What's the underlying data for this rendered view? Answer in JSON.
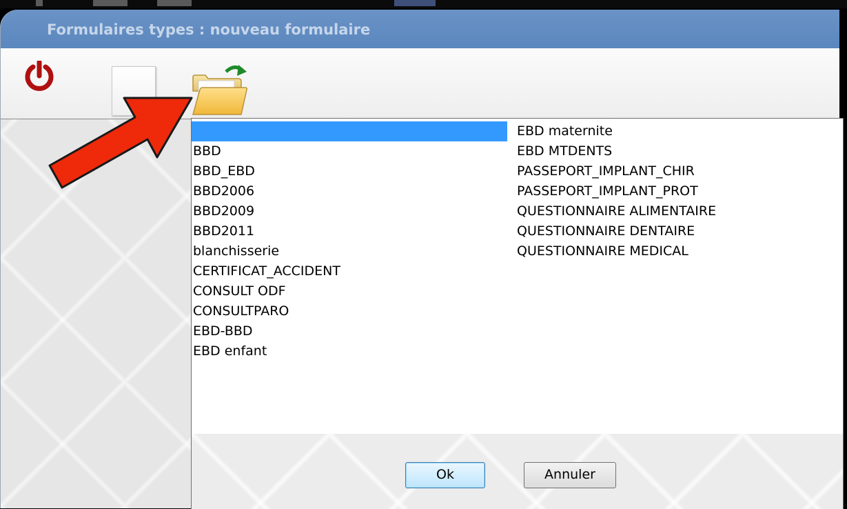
{
  "window": {
    "title": "Formulaires types : nouveau formulaire"
  },
  "toolbar": {
    "icons": [
      "power-icon",
      "blank-page-icon",
      "open-folder-icon"
    ]
  },
  "dropdown": {
    "left_items": [
      "",
      "BBD",
      "BBD_EBD",
      "BBD2006",
      "BBD2009",
      "BBD2011",
      "blanchisserie",
      "CERTIFICAT_ACCIDENT",
      "CONSULT ODF",
      "CONSULTPARO",
      "EBD-BBD",
      "EBD enfant"
    ],
    "right_items": [
      "EBD maternite",
      "EBD MTDENTS",
      "PASSEPORT_IMPLANT_CHIR",
      "PASSEPORT_IMPLANT_PROT",
      "QUESTIONNAIRE ALIMENTAIRE",
      "QUESTIONNAIRE DENTAIRE",
      "QUESTIONNAIRE MEDICAL"
    ],
    "selected_index": 0,
    "ok_label": "Ok",
    "cancel_label": "Annuler"
  },
  "colors": {
    "titlebar": "#5a87be",
    "selection": "#3399ff",
    "power_icon": "#b01010",
    "annotation_arrow": "#ee2a0b"
  }
}
